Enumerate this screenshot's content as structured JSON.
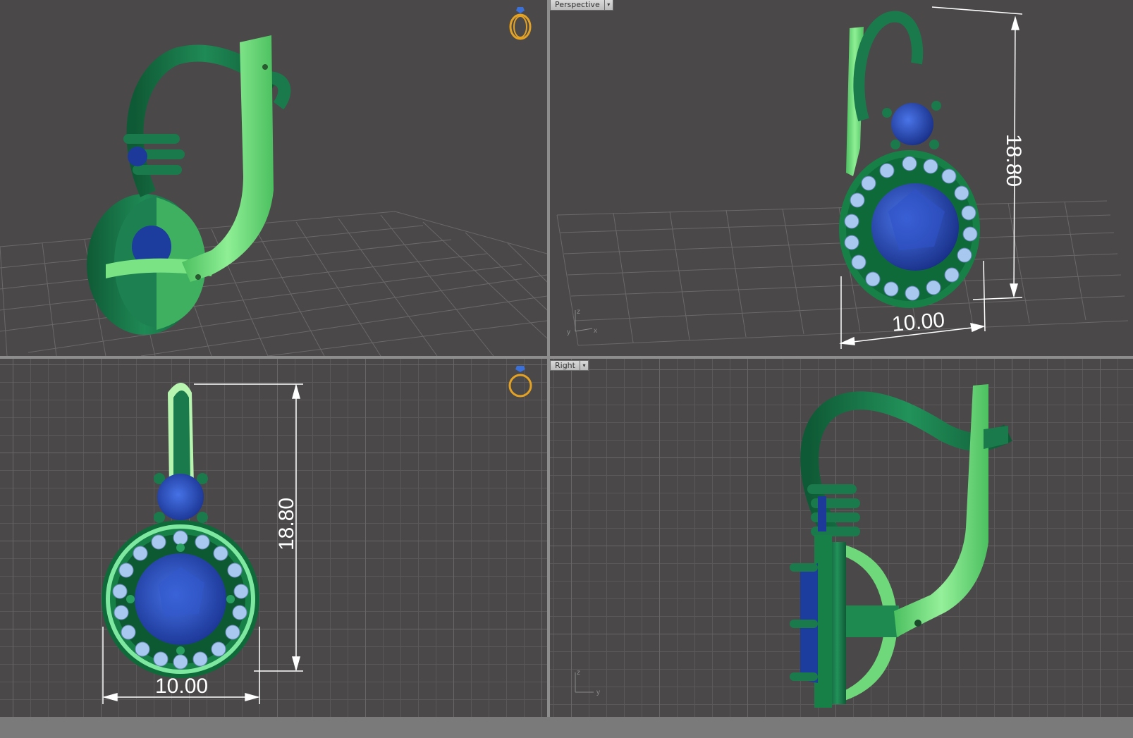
{
  "viewports": {
    "top_left": {
      "name": "",
      "icon": "ring-icon"
    },
    "top_right": {
      "name": "Perspective",
      "height_dim": "18.80",
      "width_dim": "10.00"
    },
    "bottom_left": {
      "name": "",
      "icon": "ring-icon",
      "height_dim": "18.80",
      "width_dim": "10.00"
    },
    "bottom_right": {
      "name": "Right"
    }
  },
  "axis_labels": {
    "perspective": {
      "z": "z",
      "y": "y",
      "x": "x"
    },
    "right": {
      "z": "z",
      "y": "y"
    }
  },
  "colors": {
    "background": "#4a4848",
    "grid_line": "#5e5c5c",
    "grid_major": "#706e6e",
    "metal_dark": "#1a7a4c",
    "metal_light": "#6fd87a",
    "sapphire": "#1e3a9c",
    "accent_stone": "#a9c8f0",
    "ring_icon": "#e3a224"
  }
}
